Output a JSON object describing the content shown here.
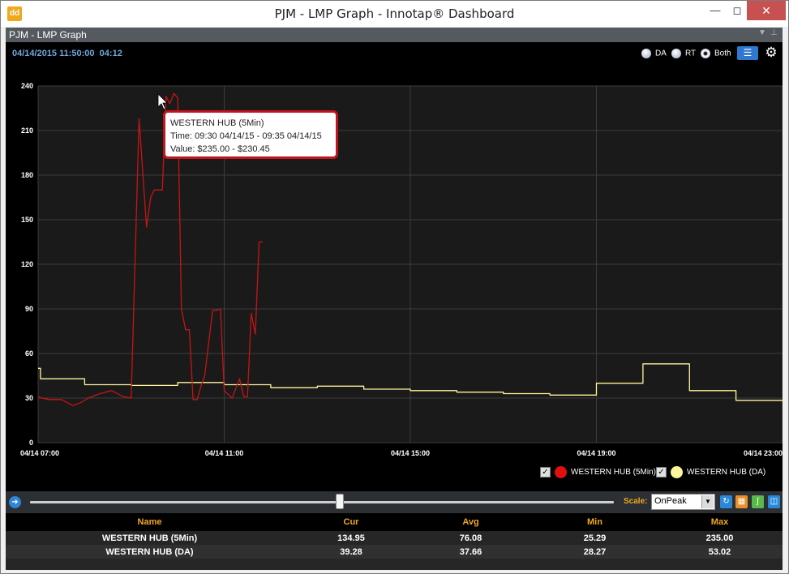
{
  "window": {
    "title": "PJM - LMP Graph - Innotap® Dashboard",
    "app_icon": "innotap-logo-icon",
    "controls": [
      "minimize",
      "maximize",
      "close"
    ]
  },
  "panel": {
    "title": "PJM - LMP Graph"
  },
  "toolbar": {
    "datetime": "04/14/2015 11:50:00",
    "countdown": "04:12",
    "radios": [
      {
        "label": "DA",
        "selected": false
      },
      {
        "label": "RT",
        "selected": false
      },
      {
        "label": "Both",
        "selected": true
      }
    ],
    "list_icon": "list-icon",
    "settings_icon": "gear-icon"
  },
  "tooltip": {
    "series": "WESTERN HUB (5Min)",
    "time": "Time: 09:30 04/14/15 - 09:35 04/14/15",
    "value": "Value: $235.00 - $230.45"
  },
  "legend": [
    {
      "label": "WESTERN HUB (5Min)",
      "checked": true,
      "color": "#e01010"
    },
    {
      "label": "WESTERN HUB (DA)",
      "checked": true,
      "color": "#fff59a"
    }
  ],
  "chart_data": {
    "type": "line",
    "ylim": [
      0,
      240
    ],
    "y_ticks": [
      "0",
      "30",
      "60",
      "90",
      "120",
      "150",
      "180",
      "210",
      "240"
    ],
    "x_range_hours": [
      7,
      23
    ],
    "x_ticks": [
      {
        "hour": 7,
        "label": "04/14 07:00"
      },
      {
        "hour": 11,
        "label": "04/14 11:00"
      },
      {
        "hour": 15,
        "label": "04/14 15:00"
      },
      {
        "hour": 19,
        "label": "04/14 19:00"
      },
      {
        "hour": 23,
        "label": "04/14 23:00"
      }
    ],
    "grid": true,
    "series": [
      {
        "name": "WESTERN HUB (5Min)",
        "color": "#c81414",
        "x": [
          7.0,
          7.08,
          7.25,
          7.5,
          7.75,
          7.92,
          8.08,
          8.33,
          8.58,
          8.83,
          9.0,
          9.17,
          9.33,
          9.42,
          9.5,
          9.67,
          9.75,
          9.83,
          9.92,
          10.0,
          10.08,
          10.17,
          10.25,
          10.33,
          10.42,
          10.5,
          10.58,
          10.75,
          10.83,
          10.92,
          11.0,
          11.17,
          11.33,
          11.42,
          11.5,
          11.58,
          11.67,
          11.75,
          11.83
        ],
        "y": [
          31,
          30,
          29,
          29,
          25,
          27,
          30,
          33,
          35,
          31,
          30,
          218,
          145,
          165,
          170,
          170,
          233,
          228,
          235,
          232,
          90,
          76,
          76,
          29,
          29,
          38,
          45,
          89,
          89,
          90,
          35,
          30,
          43,
          31,
          31,
          87,
          73,
          135,
          135
        ]
      },
      {
        "name": "WESTERN HUB (DA)",
        "color": "#fff59a",
        "x": [
          7,
          7.05,
          7.05,
          8.0,
          8.0,
          9.0,
          9.0,
          10.0,
          10.0,
          11.0,
          11.0,
          12.0,
          12.0,
          13.0,
          13.0,
          14.0,
          14.0,
          15.0,
          15.0,
          16.0,
          16.0,
          17.0,
          17.0,
          18.0,
          18.0,
          19.0,
          19.0,
          20.0,
          20.0,
          21.0,
          21.0,
          22.0,
          22.0,
          23.0
        ],
        "y": [
          50,
          50,
          43,
          43,
          39,
          39,
          38.5,
          38.5,
          40.5,
          40.5,
          39,
          39,
          37,
          37,
          38,
          38,
          36,
          36,
          35,
          35,
          34,
          34,
          33,
          33,
          32,
          32,
          40,
          40,
          53,
          53,
          35,
          35,
          28.5,
          28.5
        ]
      }
    ]
  },
  "timeline": {
    "play_icon": "play-icon",
    "scale_label": "Scale:",
    "scale_value": "OnPeak",
    "position_fraction": 0.53,
    "tool_icons": [
      "refresh-icon",
      "grid-icon",
      "curve-icon",
      "save-icon"
    ]
  },
  "table": {
    "headers": [
      "Name",
      "Cur",
      "Avg",
      "Min",
      "Max"
    ],
    "rows": [
      [
        "WESTERN HUB (5Min)",
        "134.95",
        "76.08",
        "25.29",
        "235.00"
      ],
      [
        "WESTERN HUB (DA)",
        "39.28",
        "37.66",
        "28.27",
        "53.02"
      ]
    ]
  }
}
